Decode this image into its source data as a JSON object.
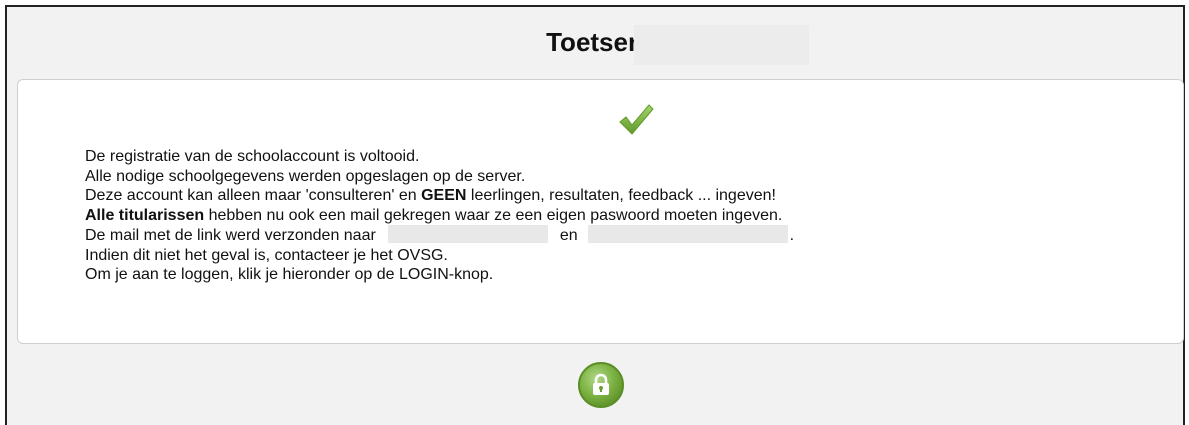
{
  "page": {
    "title": "Toetsen"
  },
  "message": {
    "line1": "De registratie van de schoolaccount is voltooid.",
    "line2": "Alle nodige schoolgegevens werden opgeslagen op de server.",
    "line3_pre": "Deze account kan alleen maar 'consulteren' en ",
    "line3_bold": "GEEN",
    "line3_post": " leerlingen, resultaten, feedback ... ingeven!",
    "line4_bold": "Alle titularissen",
    "line4_post": " hebben nu ook een mail gekregen waar ze een eigen paswoord moeten ingeven.",
    "line5_pre": "De mail met de link werd verzonden naar",
    "line5_mid": "en",
    "line5_end": ".",
    "line6": "Indien dit niet het geval is, contacteer je het OVSG.",
    "line7": "Om je aan te loggen, klik je hieronder op de LOGIN-knop."
  },
  "icons": {
    "success": "checkmark-icon",
    "login": "lock-icon"
  },
  "colors": {
    "check_green": "#7cb342",
    "login_green": "#7cb342"
  }
}
